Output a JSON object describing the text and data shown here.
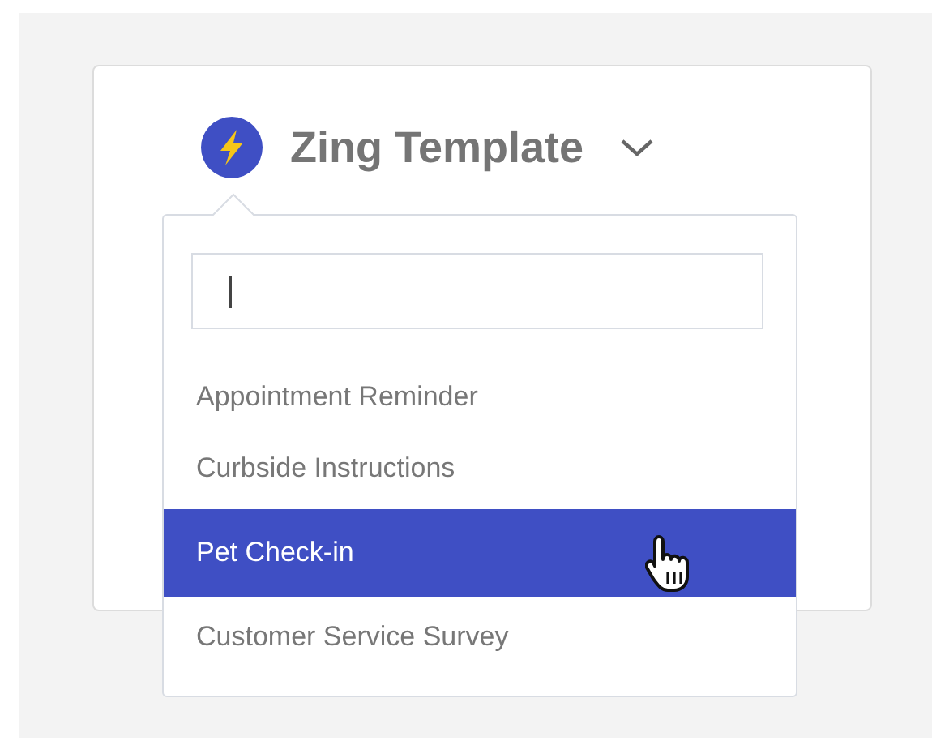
{
  "header": {
    "title": "Zing Template"
  },
  "dropdown": {
    "items": [
      {
        "label": "Appointment Reminder",
        "selected": false
      },
      {
        "label": "Curbside Instructions",
        "selected": false
      },
      {
        "label": "Pet Check-in",
        "selected": true
      },
      {
        "label": "Customer Service Survey",
        "selected": false
      }
    ]
  }
}
